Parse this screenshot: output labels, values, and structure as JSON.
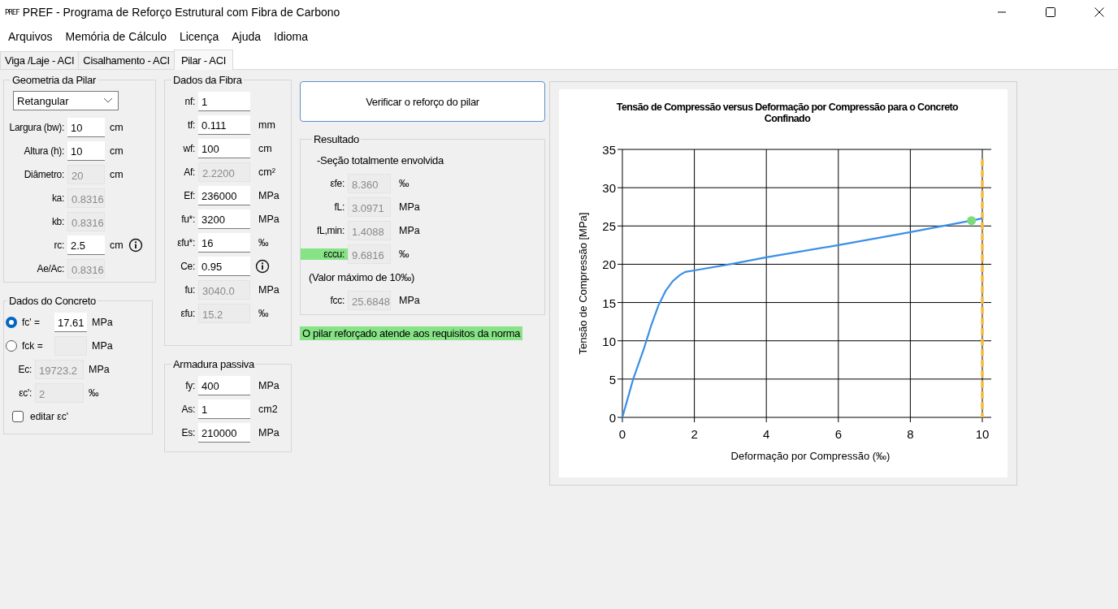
{
  "window": {
    "icon_text": "PREF",
    "title": "PREF - Programa de Reforço Estrutural com Fibra de Carbono"
  },
  "menu": [
    "Arquivos",
    "Memória de Cálculo",
    "Licença",
    "Ajuda",
    "Idioma"
  ],
  "tabs": [
    {
      "label": "Viga /Laje - ACI",
      "selected": false
    },
    {
      "label": "Cisalhamento - ACI",
      "selected": false
    },
    {
      "label": "Pilar - ACI",
      "selected": true
    }
  ],
  "columns": [
    [
      {
        "kind": "geometry",
        "title": "Geometria da Pilar",
        "rows": [
          {
            "kind": "select",
            "value": "Retangular"
          },
          {
            "kind": "field",
            "label": "Largura (bw):",
            "value": "10",
            "unit": "cm",
            "disabled": false
          },
          {
            "kind": "field",
            "label": "Altura (h):",
            "value": "10",
            "unit": "cm",
            "disabled": false
          },
          {
            "kind": "field",
            "label": "Diâmetro:",
            "value": "20",
            "unit": "cm",
            "disabled": true
          },
          {
            "kind": "field",
            "label": "ka:",
            "value": "0.8316",
            "disabled": true
          },
          {
            "kind": "field",
            "label": "kb:",
            "value": "0.8316",
            "disabled": true
          },
          {
            "kind": "field",
            "label": "rc:",
            "value": "2.5",
            "unit": "cm",
            "disabled": false,
            "info": true
          },
          {
            "kind": "field",
            "label": "Ae/Ac:",
            "value": "0.8316",
            "disabled": true
          }
        ]
      },
      {
        "kind": "concrete",
        "title": "Dados do Concreto",
        "rows": [
          {
            "kind": "radio",
            "label": "fc' =",
            "value": "17.61",
            "unit": "MPa",
            "selected": true,
            "disabled": false
          },
          {
            "kind": "radio",
            "label": "fck =",
            "unit": "MPa",
            "selected": false,
            "disabled": true
          },
          {
            "kind": "field",
            "label": "Ec:",
            "value": "19723.2",
            "unit": "MPa",
            "disabled": true
          },
          {
            "kind": "field",
            "label": "εc':",
            "value": "2",
            "unit": "‰",
            "disabled": true
          },
          {
            "kind": "checkbox",
            "label": "editar εc'",
            "checked": false
          }
        ]
      }
    ],
    [
      {
        "kind": "fiber",
        "title": "Dados da Fibra",
        "rows": [
          {
            "kind": "field",
            "label": "nf:",
            "value": "1",
            "disabled": false
          },
          {
            "kind": "field",
            "label": "tf:",
            "value": "0.111",
            "unit": "mm",
            "disabled": false
          },
          {
            "kind": "field",
            "label": "wf:",
            "value": "100",
            "unit": "cm",
            "disabled": false
          },
          {
            "kind": "field",
            "label": "Af:",
            "value": "2.2200",
            "unit": "cm²",
            "disabled": true
          },
          {
            "kind": "field",
            "label": "Ef:",
            "value": "236000",
            "unit": "MPa",
            "disabled": false
          },
          {
            "kind": "field",
            "label": "fu*:",
            "value": "3200",
            "unit": "MPa",
            "disabled": false
          },
          {
            "kind": "field",
            "label": "εfu*:",
            "value": "16",
            "unit": "‰",
            "disabled": false
          },
          {
            "kind": "field",
            "label": "Ce:",
            "value": "0.95",
            "disabled": false,
            "info": true
          },
          {
            "kind": "field",
            "label": "fu:",
            "value": "3040.0",
            "unit": "MPa",
            "disabled": true
          },
          {
            "kind": "field",
            "label": "εfu:",
            "value": "15.2",
            "unit": "‰",
            "disabled": true
          }
        ]
      },
      {
        "kind": "rebar",
        "title": "Armadura passiva",
        "rows": [
          {
            "kind": "field",
            "label": "fy:",
            "value": "400",
            "unit": "MPa",
            "disabled": false
          },
          {
            "kind": "field",
            "label": "As:",
            "value": "1",
            "unit": "cm2",
            "disabled": false
          },
          {
            "kind": "field",
            "label": "Es:",
            "value": "210000",
            "unit": "MPa",
            "disabled": false
          }
        ]
      }
    ]
  ],
  "verify_button": "Verificar o reforço do pilar",
  "result": {
    "kind": "result",
    "title": "Resultado",
    "rows": [
      {
        "kind": "note",
        "text": "-Seção totalmente envolvida"
      },
      {
        "kind": "field",
        "label": "εfe:",
        "value": "8.360",
        "unit": "‰",
        "disabled": true,
        "highlighted": false
      },
      {
        "kind": "field",
        "label": "fL:",
        "value": "3.0971",
        "unit": "MPa",
        "disabled": true,
        "highlighted": false
      },
      {
        "kind": "field",
        "label": "fL,min:",
        "value": "1.4088",
        "unit": "MPa",
        "disabled": true,
        "highlighted": false
      },
      {
        "kind": "field",
        "label": "εccu:",
        "value": "9.6816",
        "unit": "‰",
        "disabled": true,
        "highlighted": true
      },
      {
        "kind": "note",
        "text": "(Valor máximo de 10‰)"
      },
      {
        "kind": "field",
        "label": "fcc:",
        "value": "25.6848",
        "unit": "MPa",
        "disabled": true,
        "highlighted": false
      }
    ]
  },
  "status_message": "O pilar reforçado atende aos requisitos da norma",
  "chart": {
    "chart_data": {
      "type": "line",
      "title": "Tensão de Compressão versus Deformação por Compressão para o Concreto Confinado",
      "xlabel": "Deformação por Compressão (‰)",
      "ylabel": "Tensão de Compressão [MPa]",
      "x": [
        0,
        0.3,
        0.6,
        0.8,
        1,
        1.2,
        1.4,
        1.6,
        1.75,
        2,
        3,
        4,
        6,
        8,
        9.7,
        10
      ],
      "series": [
        {
          "color": "#3a8fe8",
          "marker": "none",
          "values": [
            0,
            5,
            9,
            12,
            14.6,
            16.5,
            17.8,
            18.6,
            19,
            19.2,
            20,
            20.9,
            22.5,
            24.2,
            25.7,
            26
          ]
        },
        {
          "color": "#7ddc7a",
          "marker": "circle",
          "values": [
            null,
            null,
            null,
            null,
            null,
            null,
            null,
            null,
            null,
            null,
            null,
            null,
            null,
            null,
            25.7,
            null
          ]
        }
      ],
      "xlim": [
        0,
        10
      ],
      "ylim": [
        0,
        35
      ],
      "xticks": [
        0,
        2,
        4,
        6,
        8,
        10
      ],
      "yticks": [
        0,
        5,
        10,
        15,
        20,
        25,
        30,
        35
      ],
      "grid": true,
      "ref_lines": [
        {
          "axis": "x",
          "value": 10
        }
      ]
    }
  }
}
